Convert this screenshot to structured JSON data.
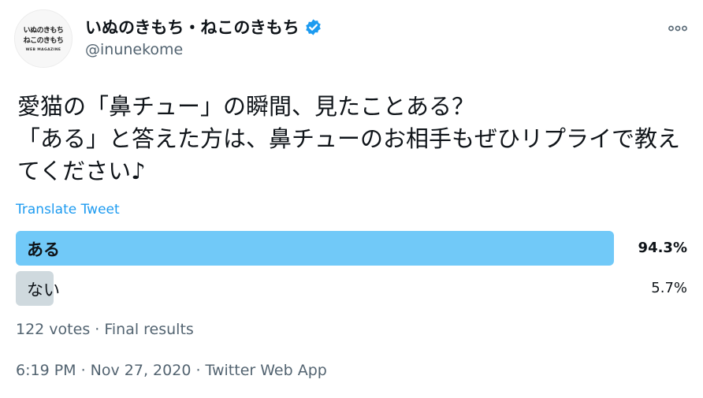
{
  "avatar": {
    "line1": "いぬのきもち",
    "line2": "ねこのきもち",
    "line3": "WEB MAGAZINE"
  },
  "account": {
    "display_name": "いぬのきもち・ねこのきもち",
    "handle": "@inunekome"
  },
  "more_icon": "more-dots-icon",
  "tweet": {
    "text": "愛猫の「鼻チュー」の瞬間、見たことある？\n「ある」と答えた方は、鼻チューのお相手もぜひリプライで教えてください♪",
    "translate_label": "Translate Tweet"
  },
  "poll": {
    "options": [
      {
        "label": "ある",
        "percent_label": "94.3%",
        "percent": 94.3,
        "winner": true
      },
      {
        "label": "ない",
        "percent_label": "5.7%",
        "percent": 5.7,
        "winner": false
      }
    ],
    "summary": "122 votes · Final results"
  },
  "meta": "6:19 PM · Nov 27, 2020 · Twitter Web App",
  "colors": {
    "winner_bar": "#71c9f8",
    "loser_bar": "#cfd9de",
    "link": "#1d9bf0",
    "secondary": "#536471",
    "verified": "#1d9bf0"
  }
}
